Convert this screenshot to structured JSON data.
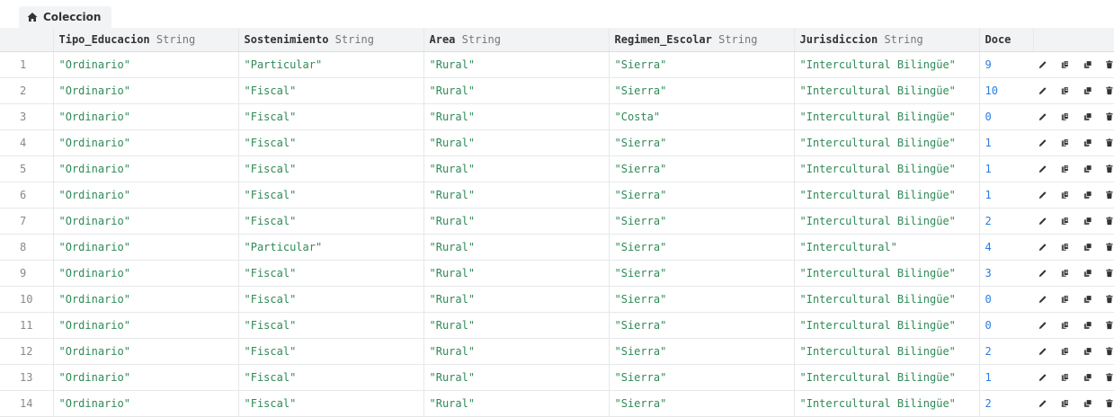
{
  "tab": {
    "label": "Coleccion",
    "icon": "home-icon"
  },
  "columns": [
    {
      "name": "Tipo_Educacion",
      "type": "String"
    },
    {
      "name": "Sostenimiento",
      "type": "String"
    },
    {
      "name": "Area",
      "type": "String"
    },
    {
      "name": "Regimen_Escolar",
      "type": "String"
    },
    {
      "name": "Jurisdiccion",
      "type": "String"
    },
    {
      "name": "Doce",
      "type": ""
    }
  ],
  "rows": [
    {
      "n": "1",
      "tipo": "\"Ordinario\"",
      "sost": "\"Particular\"",
      "area": "\"Rural\"",
      "reg": "\"Sierra\"",
      "jur": "\"Intercultural Bilingüe\"",
      "doce": "9"
    },
    {
      "n": "2",
      "tipo": "\"Ordinario\"",
      "sost": "\"Fiscal\"",
      "area": "\"Rural\"",
      "reg": "\"Sierra\"",
      "jur": "\"Intercultural Bilingüe\"",
      "doce": "10"
    },
    {
      "n": "3",
      "tipo": "\"Ordinario\"",
      "sost": "\"Fiscal\"",
      "area": "\"Rural\"",
      "reg": "\"Costa\"",
      "jur": "\"Intercultural Bilingüe\"",
      "doce": "0"
    },
    {
      "n": "4",
      "tipo": "\"Ordinario\"",
      "sost": "\"Fiscal\"",
      "area": "\"Rural\"",
      "reg": "\"Sierra\"",
      "jur": "\"Intercultural Bilingüe\"",
      "doce": "1"
    },
    {
      "n": "5",
      "tipo": "\"Ordinario\"",
      "sost": "\"Fiscal\"",
      "area": "\"Rural\"",
      "reg": "\"Sierra\"",
      "jur": "\"Intercultural Bilingüe\"",
      "doce": "1"
    },
    {
      "n": "6",
      "tipo": "\"Ordinario\"",
      "sost": "\"Fiscal\"",
      "area": "\"Rural\"",
      "reg": "\"Sierra\"",
      "jur": "\"Intercultural Bilingüe\"",
      "doce": "1"
    },
    {
      "n": "7",
      "tipo": "\"Ordinario\"",
      "sost": "\"Fiscal\"",
      "area": "\"Rural\"",
      "reg": "\"Sierra\"",
      "jur": "\"Intercultural Bilingüe\"",
      "doce": "2"
    },
    {
      "n": "8",
      "tipo": "\"Ordinario\"",
      "sost": "\"Particular\"",
      "area": "\"Rural\"",
      "reg": "\"Sierra\"",
      "jur": "\"Intercultural\"",
      "doce": "4"
    },
    {
      "n": "9",
      "tipo": "\"Ordinario\"",
      "sost": "\"Fiscal\"",
      "area": "\"Rural\"",
      "reg": "\"Sierra\"",
      "jur": "\"Intercultural Bilingüe\"",
      "doce": "3"
    },
    {
      "n": "10",
      "tipo": "\"Ordinario\"",
      "sost": "\"Fiscal\"",
      "area": "\"Rural\"",
      "reg": "\"Sierra\"",
      "jur": "\"Intercultural Bilingüe\"",
      "doce": "0"
    },
    {
      "n": "11",
      "tipo": "\"Ordinario\"",
      "sost": "\"Fiscal\"",
      "area": "\"Rural\"",
      "reg": "\"Sierra\"",
      "jur": "\"Intercultural Bilingüe\"",
      "doce": "0"
    },
    {
      "n": "12",
      "tipo": "\"Ordinario\"",
      "sost": "\"Fiscal\"",
      "area": "\"Rural\"",
      "reg": "\"Sierra\"",
      "jur": "\"Intercultural Bilingüe\"",
      "doce": "2"
    },
    {
      "n": "13",
      "tipo": "\"Ordinario\"",
      "sost": "\"Fiscal\"",
      "area": "\"Rural\"",
      "reg": "\"Sierra\"",
      "jur": "\"Intercultural Bilingüe\"",
      "doce": "1"
    },
    {
      "n": "14",
      "tipo": "\"Ordinario\"",
      "sost": "\"Fiscal\"",
      "area": "\"Rural\"",
      "reg": "\"Sierra\"",
      "jur": "\"Intercultural Bilingüe\"",
      "doce": "2"
    }
  ],
  "row_actions": [
    "pencil-icon",
    "copy-icon",
    "clone-icon",
    "trash-icon"
  ],
  "colors": {
    "string_value": "#2f8a57",
    "number_value": "#2a7de1",
    "header_bg": "#f1f3f4"
  }
}
